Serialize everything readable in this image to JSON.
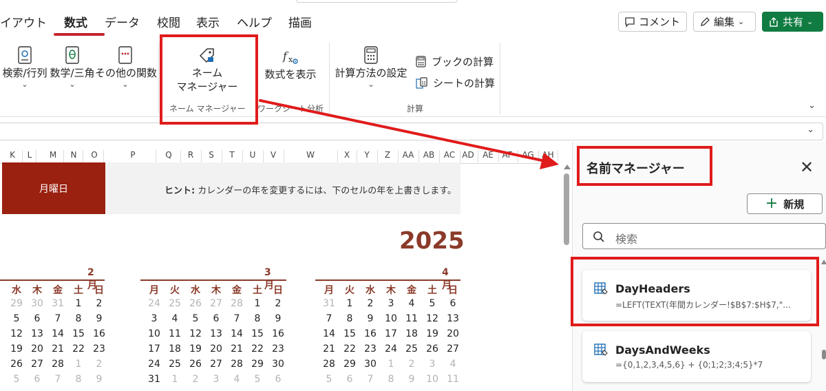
{
  "tabs": [
    "イアウト",
    "数式",
    "データ",
    "校閲",
    "表示",
    "ヘルプ",
    "描画"
  ],
  "active_tab": "数式",
  "top_buttons": {
    "comment": "コメント",
    "edit": "編集",
    "share": "共有"
  },
  "ribbon": {
    "lookup": "検索/行列",
    "math": "数学/三角",
    "more_functions": "その他の関数",
    "name_manager_line1": "ネーム",
    "name_manager_line2": "マネージャー",
    "name_manager_group": "ネーム マネージャー",
    "show_formulas": "数式を表示",
    "worksheet_group": "ワークシート分析",
    "calc_options": "計算方法の設定",
    "calc_book": "ブックの計算",
    "calc_sheet": "シートの計算",
    "calc_group": "計算"
  },
  "columns": [
    "K",
    "L",
    "M",
    "N",
    "O",
    "P",
    "Q",
    "R",
    "S",
    "T",
    "U",
    "V",
    "W",
    "X",
    "Y",
    "Z",
    "AA",
    "AB",
    "AC",
    "AD",
    "AE",
    "AF",
    "AG",
    "AH"
  ],
  "sheet": {
    "month_banner": "月曜日",
    "hint_label": "ヒント:",
    "hint_text": "カレンダーの年を変更するには、下のセルの年を上書きします。",
    "year": "2025"
  },
  "calendar": {
    "months": [
      {
        "title": "2月",
        "dow": [
          "水",
          "木",
          "金",
          "土",
          "日"
        ],
        "weeks": [
          [
            {
              "d": "29",
              "m": true
            },
            {
              "d": "30",
              "m": true
            },
            {
              "d": "31",
              "m": true
            },
            {
              "d": "1"
            },
            {
              "d": "2"
            }
          ],
          [
            {
              "d": "5"
            },
            {
              "d": "6"
            },
            {
              "d": "7"
            },
            {
              "d": "8"
            },
            {
              "d": "9"
            }
          ],
          [
            {
              "d": "12"
            },
            {
              "d": "13"
            },
            {
              "d": "14"
            },
            {
              "d": "15"
            },
            {
              "d": "16"
            }
          ],
          [
            {
              "d": "19"
            },
            {
              "d": "20"
            },
            {
              "d": "21"
            },
            {
              "d": "22"
            },
            {
              "d": "23"
            }
          ],
          [
            {
              "d": "26"
            },
            {
              "d": "27"
            },
            {
              "d": "28"
            },
            {
              "d": "1",
              "m": true
            },
            {
              "d": "2",
              "m": true
            }
          ],
          [
            {
              "d": "5",
              "m": true
            },
            {
              "d": "6",
              "m": true
            },
            {
              "d": "7",
              "m": true
            },
            {
              "d": "8",
              "m": true
            },
            {
              "d": "9",
              "m": true
            }
          ]
        ]
      },
      {
        "title": "3月",
        "dow": [
          "月",
          "火",
          "水",
          "木",
          "金",
          "土",
          "日"
        ],
        "weeks": [
          [
            {
              "d": "24",
              "m": true
            },
            {
              "d": "25",
              "m": true
            },
            {
              "d": "26",
              "m": true
            },
            {
              "d": "27",
              "m": true
            },
            {
              "d": "28",
              "m": true
            },
            {
              "d": "1"
            },
            {
              "d": "2"
            }
          ],
          [
            {
              "d": "3"
            },
            {
              "d": "4"
            },
            {
              "d": "5"
            },
            {
              "d": "6"
            },
            {
              "d": "7"
            },
            {
              "d": "8"
            },
            {
              "d": "9"
            }
          ],
          [
            {
              "d": "10"
            },
            {
              "d": "11"
            },
            {
              "d": "12"
            },
            {
              "d": "13"
            },
            {
              "d": "14"
            },
            {
              "d": "15"
            },
            {
              "d": "16"
            }
          ],
          [
            {
              "d": "17"
            },
            {
              "d": "18"
            },
            {
              "d": "19"
            },
            {
              "d": "20"
            },
            {
              "d": "21"
            },
            {
              "d": "22"
            },
            {
              "d": "23"
            }
          ],
          [
            {
              "d": "24"
            },
            {
              "d": "25"
            },
            {
              "d": "26"
            },
            {
              "d": "27"
            },
            {
              "d": "28"
            },
            {
              "d": "29"
            },
            {
              "d": "30"
            }
          ],
          [
            {
              "d": "31"
            },
            {
              "d": "1",
              "m": true
            },
            {
              "d": "2",
              "m": true
            },
            {
              "d": "3",
              "m": true
            },
            {
              "d": "4",
              "m": true
            },
            {
              "d": "5",
              "m": true
            },
            {
              "d": "6",
              "m": true
            }
          ]
        ]
      },
      {
        "title": "4月",
        "dow": [
          "月",
          "火",
          "水",
          "木",
          "金",
          "土",
          "日"
        ],
        "weeks": [
          [
            {
              "d": "31",
              "m": true
            },
            {
              "d": "1"
            },
            {
              "d": "2"
            },
            {
              "d": "3"
            },
            {
              "d": "4"
            },
            {
              "d": "5"
            },
            {
              "d": "6"
            }
          ],
          [
            {
              "d": "7"
            },
            {
              "d": "8"
            },
            {
              "d": "9"
            },
            {
              "d": "10"
            },
            {
              "d": "11"
            },
            {
              "d": "12"
            },
            {
              "d": "13"
            }
          ],
          [
            {
              "d": "14"
            },
            {
              "d": "15"
            },
            {
              "d": "16"
            },
            {
              "d": "17"
            },
            {
              "d": "18"
            },
            {
              "d": "19"
            },
            {
              "d": "20"
            }
          ],
          [
            {
              "d": "21"
            },
            {
              "d": "22"
            },
            {
              "d": "23"
            },
            {
              "d": "24"
            },
            {
              "d": "25"
            },
            {
              "d": "26"
            },
            {
              "d": "27"
            }
          ],
          [
            {
              "d": "28"
            },
            {
              "d": "29"
            },
            {
              "d": "30"
            },
            {
              "d": "1",
              "m": true
            },
            {
              "d": "2",
              "m": true
            },
            {
              "d": "3",
              "m": true
            },
            {
              "d": "4",
              "m": true
            }
          ],
          [
            {
              "d": "5",
              "m": true
            },
            {
              "d": "6",
              "m": true
            },
            {
              "d": "7",
              "m": true
            },
            {
              "d": "8",
              "m": true
            },
            {
              "d": "9",
              "m": true
            },
            {
              "d": "10",
              "m": true
            },
            {
              "d": "11",
              "m": true
            }
          ]
        ]
      }
    ]
  },
  "panel": {
    "title": "名前マネージャー",
    "new_label": "新規",
    "search_placeholder": "検索",
    "names": [
      {
        "name": "DayHeaders",
        "ref": "=LEFT(TEXT(年間カレンダー!$B$7:$H$7,\"..."
      },
      {
        "name": "DaysAndWeeks",
        "ref": "={0,1,2,3,4,5,6} + {0;1;2;3;4;5}*7"
      }
    ]
  },
  "colors": {
    "accent_red": "#e01b1b",
    "share_green": "#107c41",
    "banner": "#9a2010",
    "calendar_brown": "#8b3a2a"
  }
}
